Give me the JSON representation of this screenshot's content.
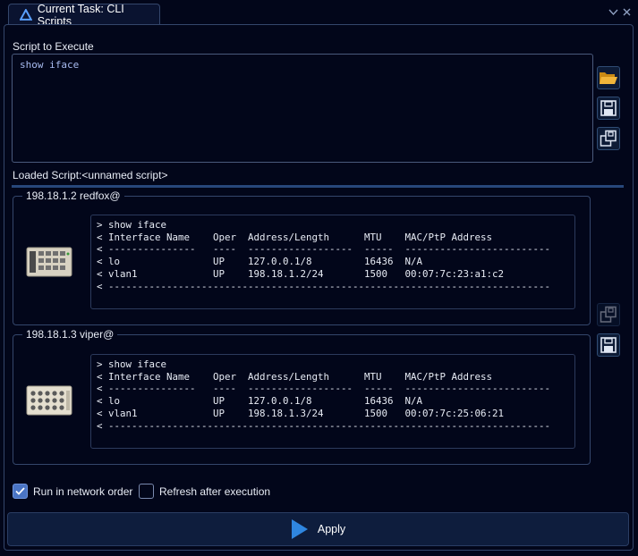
{
  "tab": {
    "title": "Current Task: CLI Scripts"
  },
  "script": {
    "label": "Script to Execute",
    "value": "show iface",
    "loaded_label": "Loaded Script:",
    "loaded_name": "<unnamed script>"
  },
  "devices": [
    {
      "title": "198.18.1.2 redfox@",
      "lines": [
        "> show iface",
        "< Interface Name    Oper  Address/Length      MTU    MAC/PtP Address",
        "< ---------------   ----  ------------------  -----  -------------------------",
        "< lo                UP    127.0.0.1/8         16436  N/A",
        "< vlan1             UP    198.18.1.2/24       1500   00:07:7c:23:a1:c2",
        "< ----------------------------------------------------------------------------"
      ]
    },
    {
      "title": "198.18.1.3 viper@",
      "lines": [
        "> show iface",
        "< Interface Name    Oper  Address/Length      MTU    MAC/PtP Address",
        "< ---------------   ----  ------------------  -----  -------------------------",
        "< lo                UP    127.0.0.1/8         16436  N/A",
        "< vlan1             UP    198.18.1.3/24       1500   00:07:7c:25:06:21",
        "< ----------------------------------------------------------------------------"
      ]
    }
  ],
  "options": {
    "run_in_order": {
      "label": "Run in network order",
      "checked": true
    },
    "refresh_after": {
      "label": "Refresh after execution",
      "checked": false
    }
  },
  "apply": {
    "label": "Apply"
  },
  "colors": {
    "accent": "#4a74c4",
    "background": "#02061a",
    "border": "#34466b",
    "apply_icon": "#2f86e0"
  },
  "icons": {
    "open": "folder-open-icon",
    "save": "save-icon",
    "save_as": "save-as-icon",
    "dropdown": "chevron-down-icon",
    "close": "close-icon",
    "apply": "play-icon"
  }
}
